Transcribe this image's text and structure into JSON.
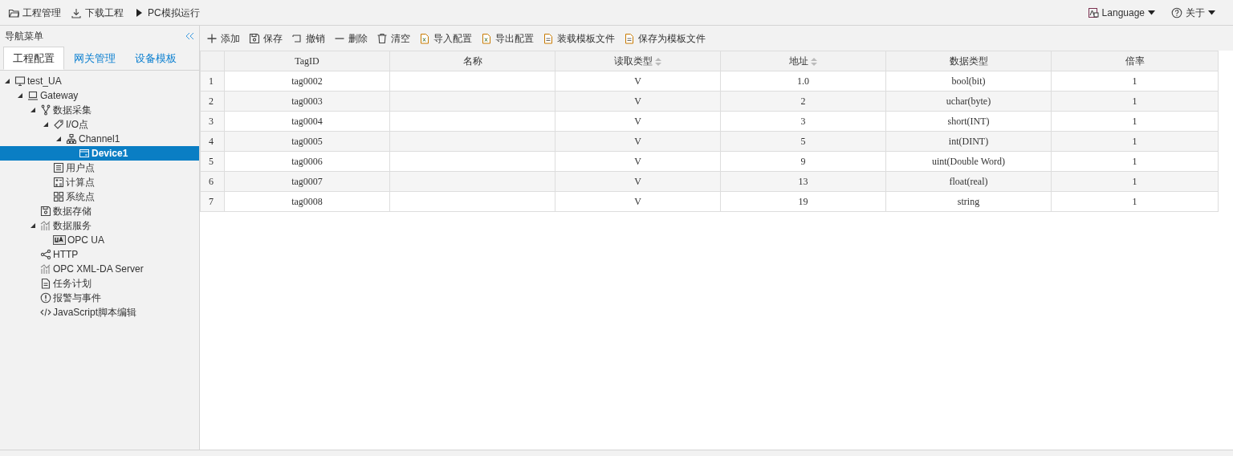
{
  "top_menu": [
    {
      "kind": "folder",
      "label": "工程管理"
    },
    {
      "kind": "download",
      "label": "下载工程"
    },
    {
      "kind": "play",
      "label": "PC模拟运行"
    }
  ],
  "top_right": [
    {
      "kind": "language",
      "label": "Language"
    },
    {
      "kind": "help",
      "label": "关于"
    }
  ],
  "sidebar": {
    "title": "导航菜单",
    "tabs": [
      {
        "label": "工程配置",
        "selected": true
      },
      {
        "label": "网关管理",
        "selected": false
      },
      {
        "label": "设备模板",
        "selected": false
      }
    ],
    "tree": [
      {
        "label": "test_UA",
        "kind": "monitor",
        "selected": false,
        "expanded": true,
        "children": [
          {
            "label": "Gateway",
            "kind": "laptop",
            "selected": false,
            "expanded": true,
            "children": [
              {
                "label": "数据采集",
                "kind": "fork",
                "selected": false,
                "expanded": true,
                "children": [
                  {
                    "label": "I/O点",
                    "kind": "tag",
                    "selected": false,
                    "expanded": true,
                    "children": [
                      {
                        "label": "Channel1",
                        "kind": "network",
                        "selected": false,
                        "expanded": true,
                        "children": [
                          {
                            "label": "Device1",
                            "kind": "device",
                            "selected": true
                          }
                        ]
                      }
                    ]
                  },
                  {
                    "label": "用户点",
                    "kind": "list",
                    "selected": false
                  },
                  {
                    "label": "计算点",
                    "kind": "calc",
                    "selected": false
                  },
                  {
                    "label": "系统点",
                    "kind": "grid",
                    "selected": false
                  }
                ]
              },
              {
                "label": "数据存储",
                "kind": "save",
                "selected": false
              },
              {
                "label": "数据服务",
                "kind": "chart",
                "selected": false,
                "expanded": true,
                "children": [
                  {
                    "label": "OPC UA",
                    "kind": "ua",
                    "selected": false
                  }
                ]
              },
              {
                "label": "HTTP",
                "kind": "share",
                "selected": false
              },
              {
                "label": "OPC XML-DA Server",
                "kind": "chart",
                "selected": false
              },
              {
                "label": "任务计划",
                "kind": "doc",
                "selected": false
              },
              {
                "label": "报警与事件",
                "kind": "alert",
                "selected": false
              },
              {
                "label": "JavaScript脚本编辑",
                "kind": "code",
                "selected": false
              }
            ]
          }
        ]
      }
    ]
  },
  "toolbar": [
    {
      "kind": "plus",
      "label": "添加"
    },
    {
      "kind": "save",
      "label": "保存"
    },
    {
      "kind": "undo",
      "label": "撤销"
    },
    {
      "kind": "minus",
      "label": "删除"
    },
    {
      "kind": "trash",
      "label": "清空"
    },
    {
      "kind": "xls",
      "label": "导入配置"
    },
    {
      "kind": "xls",
      "label": "导出配置"
    },
    {
      "kind": "file",
      "label": "装载模板文件"
    },
    {
      "kind": "file",
      "label": "保存为模板文件"
    }
  ],
  "table": {
    "columns": [
      {
        "label": "TagID",
        "sortable": false
      },
      {
        "label": "名称",
        "sortable": false
      },
      {
        "label": "读取类型",
        "sortable": true
      },
      {
        "label": "地址",
        "sortable": true
      },
      {
        "label": "数据类型",
        "sortable": false
      },
      {
        "label": "倍率",
        "sortable": false
      }
    ],
    "rows": [
      {
        "index": "1",
        "tag_id": "tag0002",
        "read_type": "V",
        "address": "1.0",
        "data_type": "bool(bit)",
        "ratio": "1"
      },
      {
        "index": "2",
        "tag_id": "tag0003",
        "read_type": "V",
        "address": "2",
        "data_type": "uchar(byte)",
        "ratio": "1"
      },
      {
        "index": "3",
        "tag_id": "tag0004",
        "read_type": "V",
        "address": "3",
        "data_type": "short(INT)",
        "ratio": "1"
      },
      {
        "index": "4",
        "tag_id": "tag0005",
        "read_type": "V",
        "address": "5",
        "data_type": "int(DINT)",
        "ratio": "1"
      },
      {
        "index": "5",
        "tag_id": "tag0006",
        "read_type": "V",
        "address": "9",
        "data_type": "uint(Double Word)",
        "ratio": "1"
      },
      {
        "index": "6",
        "tag_id": "tag0007",
        "read_type": "V",
        "address": "13",
        "data_type": "float(real)",
        "ratio": "1"
      },
      {
        "index": "7",
        "tag_id": "tag0008",
        "read_type": "V",
        "address": "19",
        "data_type": "string",
        "ratio": "1"
      }
    ]
  }
}
